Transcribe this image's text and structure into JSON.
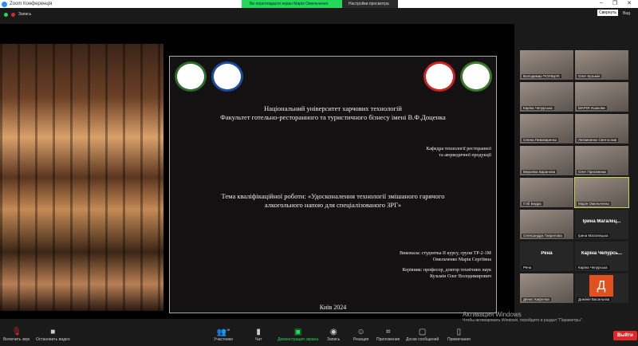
{
  "window": {
    "title": "Zoom Конференція",
    "minimize": "–",
    "restore": "❐",
    "close": "✕"
  },
  "share_banner": {
    "status": "Ви переглядаєте екран Марія Омельченко",
    "options": "Настройки просмотра ⌄"
  },
  "topbar": {
    "record": "Запись",
    "tooltip": "Свернуть",
    "view": "Вид"
  },
  "slide": {
    "title1": "Національний університет харчових технологій",
    "title2": "Факультет готельно-ресторанного та туристичного бізнесу імені В.Ф.Доценка",
    "dept1": "Кафедра технології ресторанної",
    "dept2": "та аюрведичної продукції",
    "theme1": "Тема кваліфікаційної роботи: «Удосконалення технології змішаного гарячого",
    "theme2": "алкогольного напою для спеціалізованого ЗРГ»",
    "author1": "Виконала: студентка II курсу, групи ТР-2-1М",
    "author2": "Омельченко Марія Сергіївна",
    "sup1": "Керівник: професор, доктор технічних наук",
    "sup2": "Кузьмін Олег Володимирович",
    "city": "Київ 2024"
  },
  "participants": [
    {
      "name": "Володимир ПОЛІЩУК",
      "video": true
    },
    {
      "name": "Олег Кузьмін",
      "video": true
    },
    {
      "name": "Каріна Чепурська",
      "video": true
    },
    {
      "name": "МАРІЯ Ушакова",
      "video": true
    },
    {
      "name": "Олена Пивоваренко",
      "video": true
    },
    {
      "name": "Литвиненко Святослав",
      "video": true
    },
    {
      "name": "Вероніка Баранова",
      "video": true
    },
    {
      "name": "Олег Присяжнюк",
      "video": true
    },
    {
      "name": "Гліб Бедра",
      "video": true
    },
    {
      "name": "Марія Омельченко",
      "video": true,
      "active": true
    },
    {
      "name": "Олександра Гаврилова",
      "video": true
    },
    {
      "name": "Ірина Магалецька",
      "display": "Ірина  Магалец..."
    },
    {
      "name": "Рена",
      "display": "Рена"
    },
    {
      "name": "Каріна Чепурська",
      "display": "Каріна  Чепурсь..."
    },
    {
      "name": "Денис Кифелюк",
      "video": true
    },
    {
      "name": "Домінія Васильєва",
      "avatar": "Д"
    }
  ],
  "windows_activation": {
    "title": "Активация Windows",
    "text": "Чтобы активировать Windows, перейдите в раздел \"Параметры\"."
  },
  "toolbar": {
    "unmute": "Включить звук",
    "start_video": "Остановить видео",
    "participants": "Участники",
    "participants_count": "16",
    "chat": "Чат",
    "share": "Демонстрация экрана",
    "record": "Запись",
    "reactions": "Реакция",
    "apps": "Приложения",
    "whiteboards": "Доски сообщений",
    "notes": "Примечания",
    "leave": "Выйти"
  },
  "colors": {
    "accent_green": "#23d959",
    "leave_red": "#e02828",
    "active_border": "#c7d94a"
  }
}
